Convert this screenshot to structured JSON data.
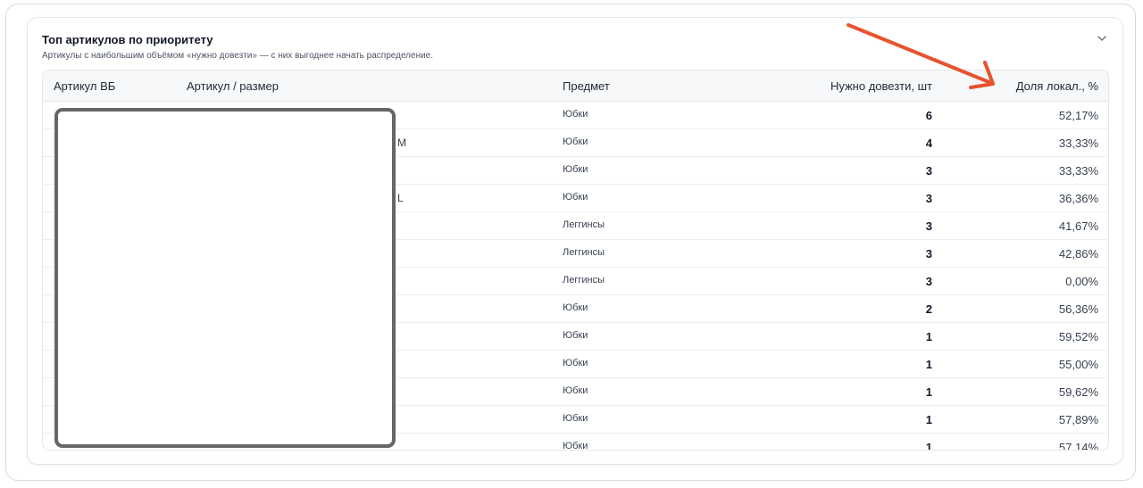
{
  "panel": {
    "title": "Топ артикулов по приоритету",
    "subtitle": "Артикулы с наибольшим объёмом «нужно довезти» — с них выгоднее начать распределение.",
    "collapse_icon": "chevron-down-icon"
  },
  "table": {
    "columns": [
      "Артикул ВБ",
      "Артикул / размер",
      "Предмет",
      "Нужно довезти, шт",
      "Доля локал., %"
    ],
    "rows": [
      {
        "size_tail": "",
        "subject": "Юбки",
        "need": "6",
        "share": "52,17%"
      },
      {
        "size_tail": "M",
        "subject": "Юбки",
        "need": "4",
        "share": "33,33%"
      },
      {
        "size_tail": "",
        "subject": "Юбки",
        "need": "3",
        "share": "33,33%"
      },
      {
        "size_tail": "L",
        "subject": "Юбки",
        "need": "3",
        "share": "36,36%"
      },
      {
        "size_tail": "",
        "subject": "Леггинсы",
        "need": "3",
        "share": "41,67%"
      },
      {
        "size_tail": "",
        "subject": "Леггинсы",
        "need": "3",
        "share": "42,86%"
      },
      {
        "size_tail": "",
        "subject": "Леггинсы",
        "need": "3",
        "share": "0,00%"
      },
      {
        "size_tail": "",
        "subject": "Юбки",
        "need": "2",
        "share": "56,36%"
      },
      {
        "size_tail": "",
        "subject": "Юбки",
        "need": "1",
        "share": "59,52%"
      },
      {
        "size_tail": "",
        "subject": "Юбки",
        "need": "1",
        "share": "55,00%"
      },
      {
        "size_tail": "",
        "subject": "Юбки",
        "need": "1",
        "share": "59,62%"
      },
      {
        "size_tail": "",
        "subject": "Юбки",
        "need": "1",
        "share": "57,89%"
      },
      {
        "size_tail": "",
        "subject": "Юбки",
        "need": "1",
        "share": "57,14%"
      }
    ]
  },
  "colors": {
    "annotation_arrow": "#e8522f",
    "redaction_border": "#666666"
  }
}
